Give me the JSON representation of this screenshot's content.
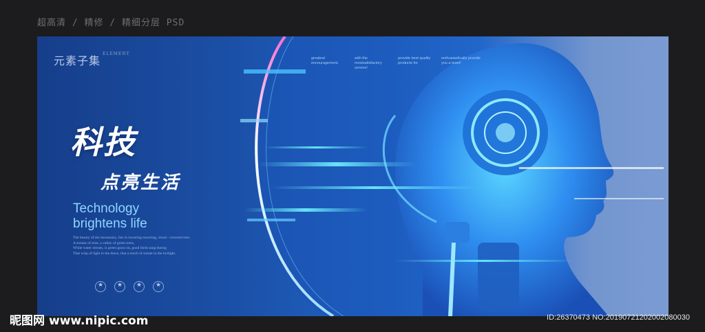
{
  "caption": "超高清 / 精修 / 精细分层 PSD",
  "banner": {
    "logo_text": "元素子集",
    "logo_small": "ELEMENT",
    "headline": "科技",
    "subheadline": "点亮生活",
    "english_line1": "Technology",
    "english_line2": "brightens life",
    "body_lines": [
      "The beauty of the mountains, lies in towering towering, cloud - covered trees",
      "A stream of mist, a valley of green trees,",
      "White water stream, is green grass on, good birds sang during",
      "That wisp of light in the dawn, that a touch of sunset in the twilight."
    ],
    "micro_texts": [
      "greatest encouragement,",
      "with the mostsatisfactory service!",
      "provide best quality products for",
      "enthusiastically provide you a team!"
    ],
    "accent_color": "#8fd6ff",
    "badge_icons": [
      "star-badge-icon",
      "star-badge-icon",
      "star-badge-icon",
      "star-badge-icon"
    ]
  },
  "watermark": {
    "site_name": "昵图网",
    "site_url": "www.nipic.com"
  },
  "image_id": "ID:26370473 NO:20190721202002080030"
}
